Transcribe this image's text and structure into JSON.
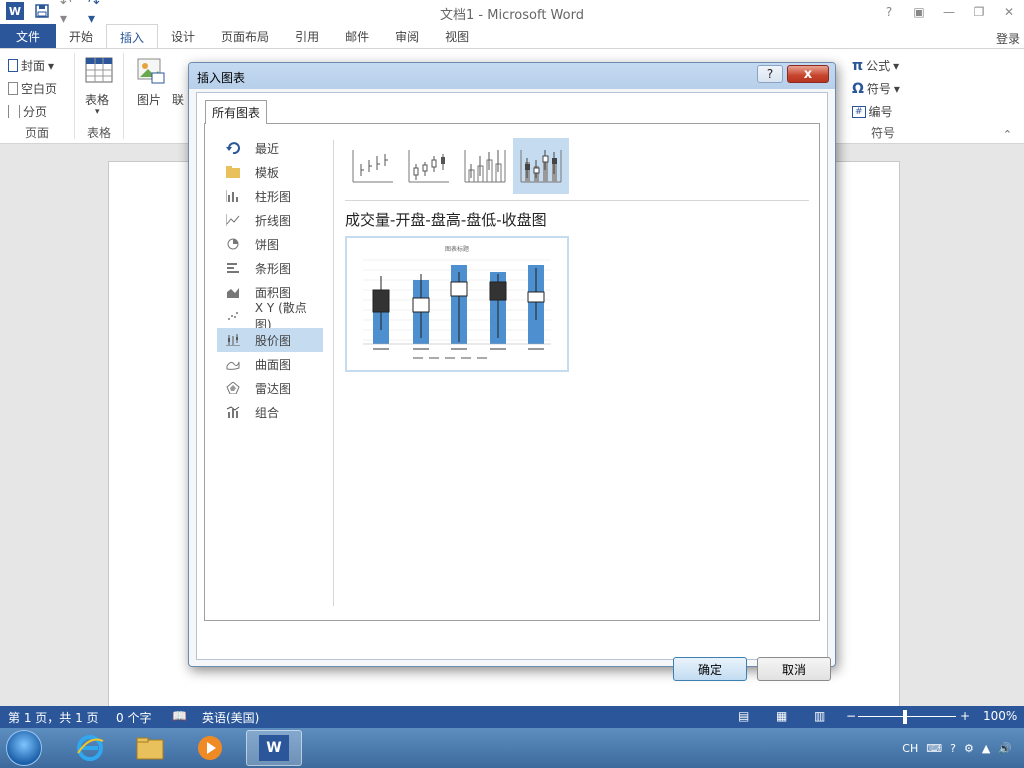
{
  "window": {
    "title": "文档1 - Microsoft Word",
    "signin": "登录"
  },
  "tabs": [
    "文件",
    "开始",
    "插入",
    "设计",
    "页面布局",
    "引用",
    "邮件",
    "审阅",
    "视图"
  ],
  "active_tab": "插入",
  "ribbon": {
    "pages_group": {
      "name": "页面",
      "cover": "封面",
      "blank": "空白页",
      "break": "分页"
    },
    "tables_group": {
      "name": "表格",
      "table": "表格"
    },
    "illus_group": {
      "picture": "图片",
      "online": "联"
    },
    "symbols_group": {
      "name": "符号",
      "equation": "公式",
      "symbol": "符号",
      "number": "编号"
    }
  },
  "dialog": {
    "title": "插入图表",
    "help_label": "?",
    "close_label": "x",
    "tab_label": "所有图表",
    "categories": [
      {
        "label": "最近",
        "icon": "recent-icon"
      },
      {
        "label": "模板",
        "icon": "folder-icon"
      },
      {
        "label": "柱形图",
        "icon": "column-chart-icon"
      },
      {
        "label": "折线图",
        "icon": "line-chart-icon"
      },
      {
        "label": "饼图",
        "icon": "pie-chart-icon"
      },
      {
        "label": "条形图",
        "icon": "bar-chart-icon"
      },
      {
        "label": "面积图",
        "icon": "area-chart-icon"
      },
      {
        "label": "X Y (散点图)",
        "icon": "scatter-chart-icon"
      },
      {
        "label": "股价图",
        "icon": "stock-chart-icon"
      },
      {
        "label": "曲面图",
        "icon": "surface-chart-icon"
      },
      {
        "label": "雷达图",
        "icon": "radar-chart-icon"
      },
      {
        "label": "组合",
        "icon": "combo-chart-icon"
      }
    ],
    "selected_category": "股价图",
    "chart_type_title": "成交量-开盘-盘高-盘低-收盘图",
    "selected_subtype_index": 3,
    "preview_title": "图表标题",
    "ok_label": "确定",
    "cancel_label": "取消"
  },
  "statusbar": {
    "page": "第 1 页，共 1 页",
    "words": "0 个字",
    "language": "英语(美国)",
    "zoom": "100%",
    "zoom_level": 1.0
  },
  "taskbar": {
    "ime": "CH"
  }
}
